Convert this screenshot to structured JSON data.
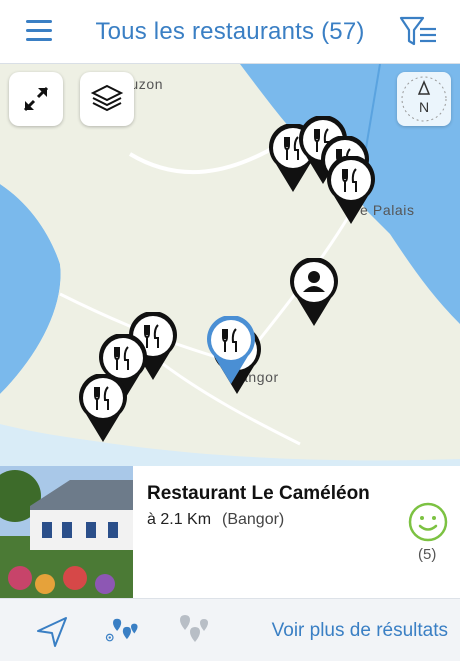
{
  "header": {
    "title": "Tous les restaurants (57)",
    "menu_icon": "hamburger-menu-icon",
    "filter_icon": "filter-list-icon",
    "accent_color": "#3a7fc4"
  },
  "map": {
    "labels": {
      "top_left": "auzon",
      "right": "e Palais",
      "center": "angor"
    },
    "controls": {
      "expand_icon": "expand-arrows-icon",
      "layers_icon": "layers-icon",
      "compass_icon": "compass-north-icon",
      "compass_letter": "N"
    },
    "markers": [
      {
        "type": "restaurant",
        "selected": false
      },
      {
        "type": "restaurant",
        "selected": false
      },
      {
        "type": "restaurant",
        "selected": false
      },
      {
        "type": "restaurant",
        "selected": false
      },
      {
        "type": "restaurant",
        "selected": false
      },
      {
        "type": "restaurant",
        "selected": false
      },
      {
        "type": "restaurant",
        "selected": false
      },
      {
        "type": "restaurant",
        "selected": false
      },
      {
        "type": "restaurant",
        "selected": true
      },
      {
        "type": "user",
        "selected": false
      }
    ]
  },
  "card": {
    "name": "Restaurant Le Caméléon",
    "distance": "à 2.1 Km",
    "city": "(Bangor)",
    "rating_icon": "smiley-icon",
    "rating_color": "#7cc242",
    "rating_count": "(5)"
  },
  "bottombar": {
    "locate_icon": "navigation-arrow-icon",
    "nearby_icon": "nearby-pins-icon",
    "all_pins_icon": "multiple-pins-icon",
    "more_label": "Voir plus de résultats"
  }
}
